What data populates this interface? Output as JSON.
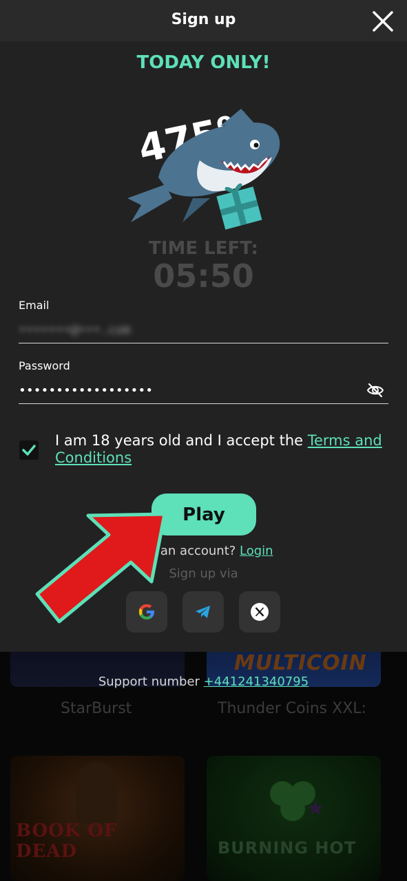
{
  "modal": {
    "title": "Sign up",
    "promo_title": "TODAY ONLY!",
    "bonus_percent": "475%",
    "timer": {
      "label": "TIME LEFT:",
      "value": "05:50"
    },
    "email": {
      "label": "Email",
      "value": "•••••••@•••.com"
    },
    "password": {
      "label": "Password",
      "value": "••••••••••••••••••"
    },
    "terms": {
      "checked": true,
      "text": "I am 18 years old and I accept the ",
      "link": "Terms and Conditions"
    },
    "play_label": "Play",
    "login_prefix": "ave an account? ",
    "login_link": "Login",
    "signup_via": "Sign up via",
    "social": [
      "google-icon",
      "telegram-icon",
      "x-icon"
    ]
  },
  "background": {
    "support_prefix": "Support number ",
    "support_number": "+441241340795",
    "games": [
      {
        "name": "StarBurst"
      },
      {
        "name": "Thunder Coins XXL:",
        "logo": "MULTICOIN"
      },
      {
        "title": "BOOK OF DEAD"
      },
      {
        "title": "BURNING HOT"
      }
    ]
  },
  "colors": {
    "accent": "#5ee0b8",
    "modal_bg": "#222222",
    "arrow": "#e0191a"
  }
}
